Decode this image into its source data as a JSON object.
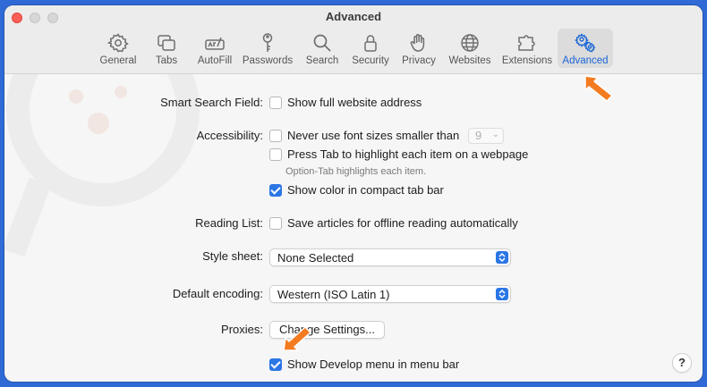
{
  "window": {
    "title": "Advanced"
  },
  "tabs": [
    {
      "label": "General",
      "icon": "gear-icon"
    },
    {
      "label": "Tabs",
      "icon": "tabs-icon"
    },
    {
      "label": "AutoFill",
      "icon": "autofill-icon"
    },
    {
      "label": "Passwords",
      "icon": "key-icon"
    },
    {
      "label": "Search",
      "icon": "magnifier-icon"
    },
    {
      "label": "Security",
      "icon": "lock-icon"
    },
    {
      "label": "Privacy",
      "icon": "hand-icon"
    },
    {
      "label": "Websites",
      "icon": "globe-icon"
    },
    {
      "label": "Extensions",
      "icon": "puzzle-icon"
    },
    {
      "label": "Advanced",
      "icon": "gears-icon",
      "selected": true
    }
  ],
  "settings": {
    "smart_search": {
      "label": "Smart Search Field:",
      "option": "Show full website address",
      "checked": false
    },
    "accessibility": {
      "label": "Accessibility:",
      "font_option": "Never use font sizes smaller than",
      "font_size": "9",
      "tab_option": "Press Tab to highlight each item on a webpage",
      "tab_hint": "Option-Tab highlights each item.",
      "color_option": "Show color in compact tab bar",
      "font_checked": false,
      "tab_checked": false,
      "color_checked": true
    },
    "reading_list": {
      "label": "Reading List:",
      "option": "Save articles for offline reading automatically",
      "checked": false
    },
    "style_sheet": {
      "label": "Style sheet:",
      "value": "None Selected"
    },
    "encoding": {
      "label": "Default encoding:",
      "value": "Western (ISO Latin 1)"
    },
    "proxies": {
      "label": "Proxies:",
      "button": "Change Settings..."
    },
    "develop": {
      "option": "Show Develop menu in menu bar",
      "checked": true
    }
  },
  "help": {
    "label": "?"
  },
  "colors": {
    "accent": "#2b76e5",
    "annotation_arrow": "#f47b20",
    "desktop": "#2f6ad6",
    "close_button": "#fe5f57"
  }
}
